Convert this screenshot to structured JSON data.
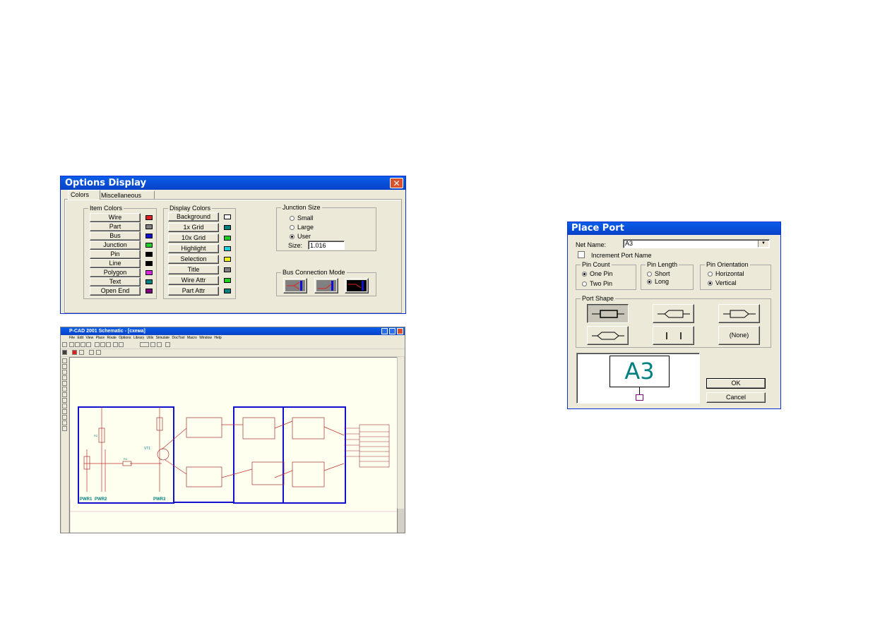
{
  "options_display": {
    "title": "Options Display",
    "close_glyph": "✕",
    "tabs": [
      "Colors",
      "Miscellaneous"
    ],
    "item_colors": {
      "title": "Item Colors",
      "items": [
        {
          "label": "Wire",
          "color": "#e02020"
        },
        {
          "label": "Part",
          "color": "#808080"
        },
        {
          "label": "Bus",
          "color": "#1010d0"
        },
        {
          "label": "Junction",
          "color": "#20d020"
        },
        {
          "label": "Pin",
          "color": "#000000"
        },
        {
          "label": "Line",
          "color": "#000000"
        },
        {
          "label": "Polygon",
          "color": "#e020e0"
        },
        {
          "label": "Text",
          "color": "#008080"
        },
        {
          "label": "Open End",
          "color": "#800080"
        }
      ]
    },
    "display_colors": {
      "title": "Display Colors",
      "items": [
        {
          "label": "Background",
          "color": "#ffffff"
        },
        {
          "label": "1x Grid",
          "color": "#008080"
        },
        {
          "label": "10x Grid",
          "color": "#20d020"
        },
        {
          "label": "Highlight",
          "color": "#20d0e0"
        },
        {
          "label": "Selection",
          "color": "#f0f020"
        },
        {
          "label": "Title",
          "color": "#808080"
        },
        {
          "label": "Wire Attr",
          "color": "#20d020"
        },
        {
          "label": "Part Attr",
          "color": "#008080"
        }
      ]
    },
    "junction_size": {
      "title": "Junction Size",
      "options": [
        "Small",
        "Large",
        "User"
      ],
      "selected": "User",
      "size_label": "Size:",
      "size_value": "1.016"
    },
    "bus_connection_mode": {
      "title": "Bus Connection Mode"
    }
  },
  "pcad": {
    "title": "P-CAD 2001 Schematic - [схема]",
    "menu": "File Edit View Place Route Options Library Utils Simulate DocTool Macro Window Help",
    "labels": {
      "pwr1": "PWR1",
      "pwr2": "PWR2",
      "pwr3": "PWR3",
      "vt1": "VT1",
      "r4": "R4",
      "r2": "R2"
    }
  },
  "place_port": {
    "title": "Place Port",
    "net_name_label": "Net Name:",
    "net_name_value": "A3",
    "increment_label": "Increment Port Name",
    "pin_count": {
      "title": "Pin Count",
      "options": [
        "One Pin",
        "Two Pin"
      ],
      "selected": "One Pin"
    },
    "pin_length": {
      "title": "Pin Length",
      "options": [
        "Short",
        "Long"
      ],
      "selected": "Long"
    },
    "pin_orientation": {
      "title": "Pin Orientation",
      "options": [
        "Horizontal",
        "Vertical"
      ],
      "selected": "Vertical"
    },
    "port_shape": {
      "title": "Port Shape",
      "none_label": "(None)"
    },
    "preview_text": "A3",
    "ok_label": "OK",
    "cancel_label": "Cancel"
  }
}
